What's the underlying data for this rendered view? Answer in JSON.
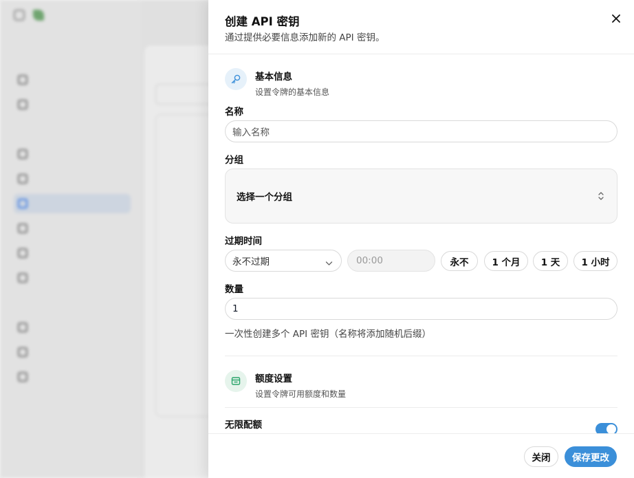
{
  "colors": {
    "accent": "#3b8fd9",
    "key_icon_bg": "#e6f1fa",
    "quota_icon_bg": "#e6f4ec",
    "quota_icon": "#2aa46a"
  },
  "sheet": {
    "title": "创建 API 密钥",
    "description": "通过提供必要信息添加新的 API 密钥。",
    "close_icon": "close-icon"
  },
  "basic_info": {
    "icon": "key-icon",
    "title": "基本信息",
    "subtitle": "设置令牌的基本信息"
  },
  "name_field": {
    "label": "名称",
    "placeholder": "输入名称"
  },
  "group_field": {
    "label": "分组",
    "placeholder": "选择一个分组"
  },
  "expiration": {
    "label": "过期时间",
    "selected": "永不过期",
    "time_placeholder": "00:00",
    "quick_options": [
      "永不",
      "1 个月",
      "1 天",
      "1 小时"
    ]
  },
  "quantity": {
    "label": "数量",
    "value": "1",
    "hint": "一次性创建多个 API 密钥（名称将添加随机后缀）"
  },
  "quota_settings": {
    "icon": "wallet-icon",
    "title": "额度设置",
    "subtitle": "设置令牌可用额度和数量"
  },
  "unlimited_quota": {
    "label": "无限配额",
    "enabled": true
  },
  "footer": {
    "close_label": "关闭",
    "save_label": "保存更改"
  }
}
